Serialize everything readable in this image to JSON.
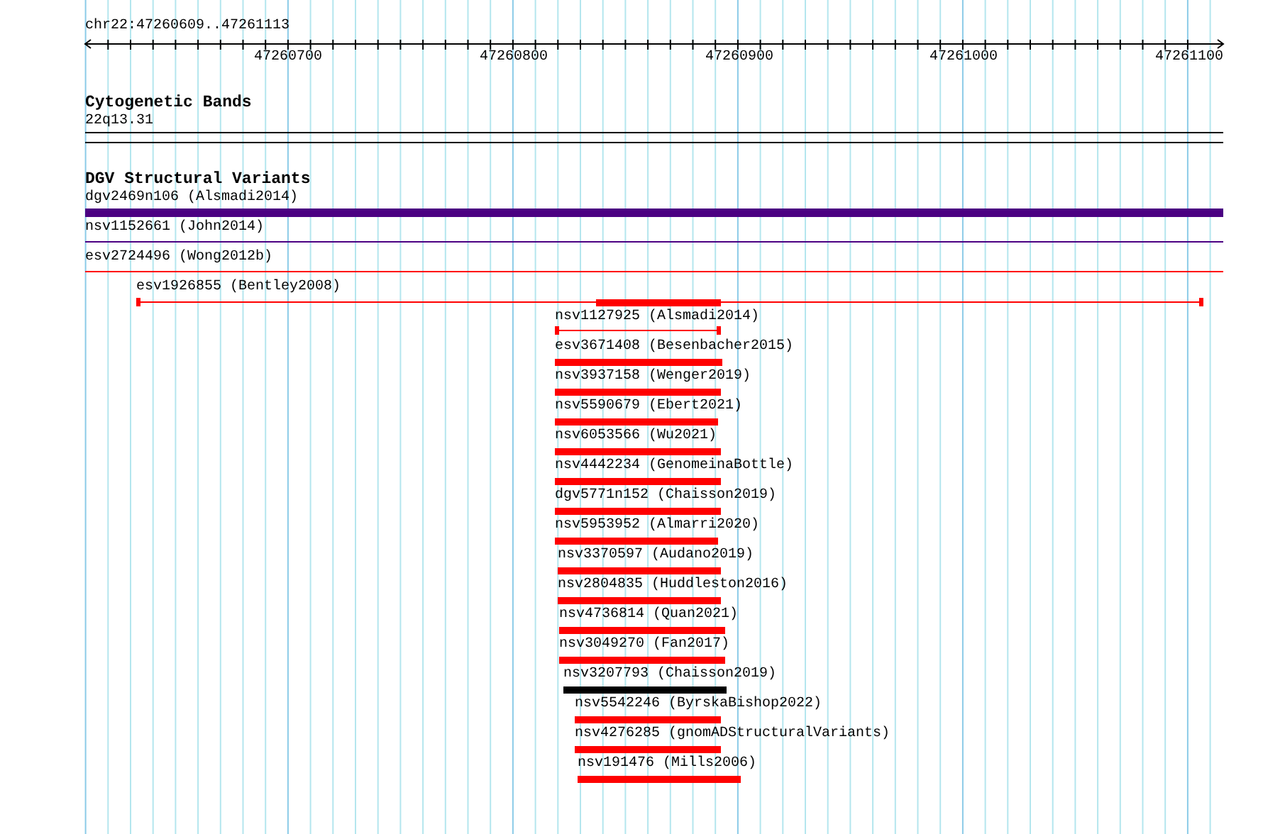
{
  "ruler": {
    "location": "chr22:47260609..47261113",
    "tick_labels": [
      "47260700",
      "47260800",
      "47260900",
      "47261000",
      "47261100"
    ]
  },
  "tracks": [
    {
      "title": "Cytogenetic Bands",
      "kind": "bands",
      "features": [
        {
          "label": "22q13.31"
        }
      ]
    },
    {
      "title": "DGV Structural Variants",
      "kind": "variants",
      "features": [
        {
          "label": "dgv2469n106 (Alsmadi2014)",
          "kind": "bar",
          "color": "#4b0082"
        },
        {
          "label": "nsv1152661 (John2014)",
          "kind": "line",
          "color": "#4b0082"
        },
        {
          "label": "esv2724496 (Wong2012b)",
          "kind": "line",
          "color": "#ff0000"
        },
        {
          "label": "esv1926855 (Bentley2008)",
          "kind": "line",
          "color": "#ff0000"
        },
        {
          "kind": "bar",
          "color": "#ff0000"
        },
        {
          "label": "nsv1127925 (Alsmadi2014)",
          "kind": "line",
          "color": "#ff0000"
        },
        {
          "label": "esv3671408 (Besenbacher2015)",
          "kind": "bar",
          "color": "#ff0000"
        },
        {
          "label": "nsv3937158 (Wenger2019)",
          "kind": "bar",
          "color": "#ff0000"
        },
        {
          "label": "nsv5590679 (Ebert2021)",
          "kind": "bar",
          "color": "#ff0000"
        },
        {
          "label": "nsv6053566 (Wu2021)",
          "kind": "bar",
          "color": "#ff0000"
        },
        {
          "label": "nsv4442234 (GenomeinaBottle)",
          "kind": "bar",
          "color": "#ff0000"
        },
        {
          "label": "dgv5771n152 (Chaisson2019)",
          "kind": "bar",
          "color": "#ff0000"
        },
        {
          "label": "nsv5953952 (Almarri2020)",
          "kind": "bar",
          "color": "#ff0000"
        },
        {
          "label": "nsv3370597 (Audano2019)",
          "kind": "bar",
          "color": "#ff0000"
        },
        {
          "label": "nsv2804835 (Huddleston2016)",
          "kind": "bar",
          "color": "#ff0000"
        },
        {
          "label": "nsv4736814 (Quan2021)",
          "kind": "bar",
          "color": "#ff0000"
        },
        {
          "label": "nsv3049270 (Fan2017)",
          "kind": "bar",
          "color": "#ff0000"
        },
        {
          "label": "nsv3207793 (Chaisson2019)",
          "kind": "bar",
          "color": "#000000"
        },
        {
          "label": "nsv5542246 (ByrskaBishop2022)",
          "kind": "bar",
          "color": "#ff0000"
        },
        {
          "label": "nsv4276285 (gnomADStructuralVariants)",
          "kind": "bar",
          "color": "#ff0000"
        },
        {
          "label": "nsv191476 (Mills2006)",
          "kind": "bar",
          "color": "#ff0000"
        }
      ]
    }
  ]
}
